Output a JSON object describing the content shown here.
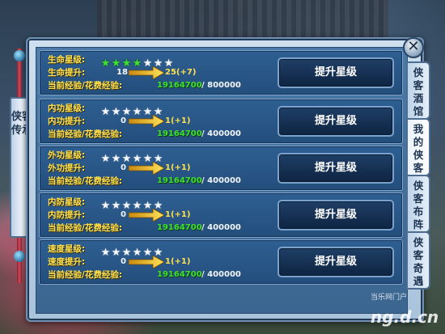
{
  "scroll_title": "侠客传承",
  "close_symbol": "✕",
  "upgrade_label": "提升星级",
  "tabs": [
    "侠客酒馆",
    "我的侠客",
    "侠客布阵",
    "侠客奇遇"
  ],
  "rows": [
    {
      "star_label": "生命星级:",
      "stars_filled": 4,
      "stars_total": 7,
      "up_label": "生命提升:",
      "current": "18",
      "next": "25(+7)",
      "exp_label": "当前经验/花费经验:",
      "exp_current": "19164700",
      "exp_cost": "/ 800000"
    },
    {
      "star_label": "内功星级:",
      "stars_filled": 0,
      "stars_total": 6,
      "up_label": "内功提升:",
      "current": "0",
      "next": "1(+1)",
      "exp_label": "当前经验/花费经验:",
      "exp_current": "19164700",
      "exp_cost": "/ 400000"
    },
    {
      "star_label": "外功星级:",
      "stars_filled": 0,
      "stars_total": 6,
      "up_label": "外功提升:",
      "current": "0",
      "next": "1(+1)",
      "exp_label": "当前经验/花费经验:",
      "exp_current": "19164700",
      "exp_cost": "/ 400000"
    },
    {
      "star_label": "内防星级:",
      "stars_filled": 0,
      "stars_total": 6,
      "up_label": "内防提升:",
      "current": "0",
      "next": "1(+1)",
      "exp_label": "当前经验/花费经验:",
      "exp_current": "19164700",
      "exp_cost": "/ 400000"
    },
    {
      "star_label": "速度星级:",
      "stars_filled": 0,
      "stars_total": 6,
      "up_label": "速度提升:",
      "current": "0",
      "next": "1(+1)",
      "exp_label": "当前经验/花费经验:",
      "exp_current": "19164700",
      "exp_cost": "/ 400000"
    }
  ],
  "watermark": {
    "top": "当乐网门户",
    "bottom": "ng.d.cn"
  },
  "colors": {
    "label_yellow": "#ffe14d",
    "value_green": "#3fe034",
    "row_blue": "#2e5f92"
  }
}
